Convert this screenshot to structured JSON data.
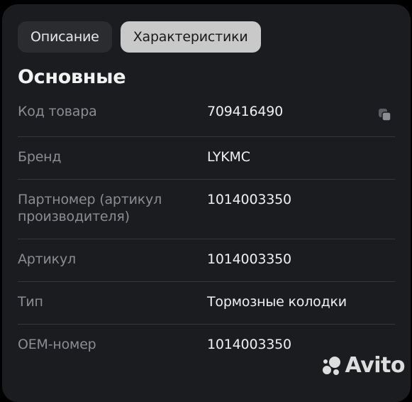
{
  "tabs": [
    {
      "label": "Описание",
      "active": false
    },
    {
      "label": "Характеристики",
      "active": true
    }
  ],
  "section_title": "Основные",
  "rows": [
    {
      "label": "Код товара",
      "value": "709416490"
    },
    {
      "label": "Бренд",
      "value": "LYKMC"
    },
    {
      "label": "Партномер (артикул\nпроизводителя)",
      "value": "1014003350"
    },
    {
      "label": "Артикул",
      "value": "1014003350"
    },
    {
      "label": "Тип",
      "value": "Тормозные колодки"
    },
    {
      "label": "OEM-номер",
      "value": "1014003350"
    }
  ],
  "watermark": "Avito",
  "colors": {
    "background": "#000000",
    "card": "#1a1c1f",
    "tab_inactive": "#2a2c30",
    "tab_active": "#c9c9c9",
    "label": "#8a8d92",
    "value": "#f0f0f0"
  }
}
